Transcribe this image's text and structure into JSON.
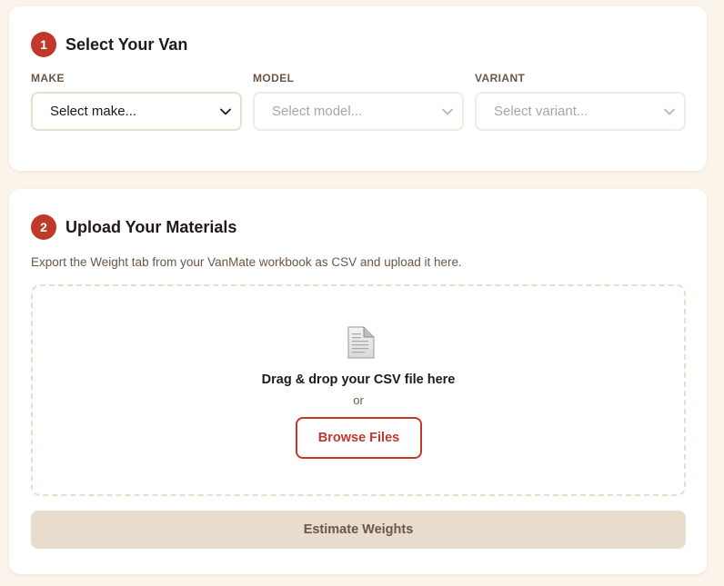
{
  "van_section": {
    "step": "1",
    "title": "Select Your Van",
    "fields": [
      {
        "label": "MAKE",
        "value": "Select make...",
        "state": "enabled"
      },
      {
        "label": "MODEL",
        "value": "Select model...",
        "state": "disabled"
      },
      {
        "label": "VARIANT",
        "value": "Select variant...",
        "state": "disabled"
      }
    ]
  },
  "upload_section": {
    "step": "2",
    "title": "Upload Your Materials",
    "helper": "Export the Weight tab from your VanMate workbook as CSV and upload it here.",
    "dropzone": {
      "icon": "document-icon",
      "title": "Drag & drop your CSV file here",
      "or_text": "or",
      "browse_label": "Browse Files"
    },
    "estimate_label": "Estimate Weights"
  },
  "colors": {
    "accent": "#c0392b",
    "page_bg": "#fbf4ea",
    "muted_text": "#6b5646",
    "disabled_button": "#e8dccd"
  }
}
